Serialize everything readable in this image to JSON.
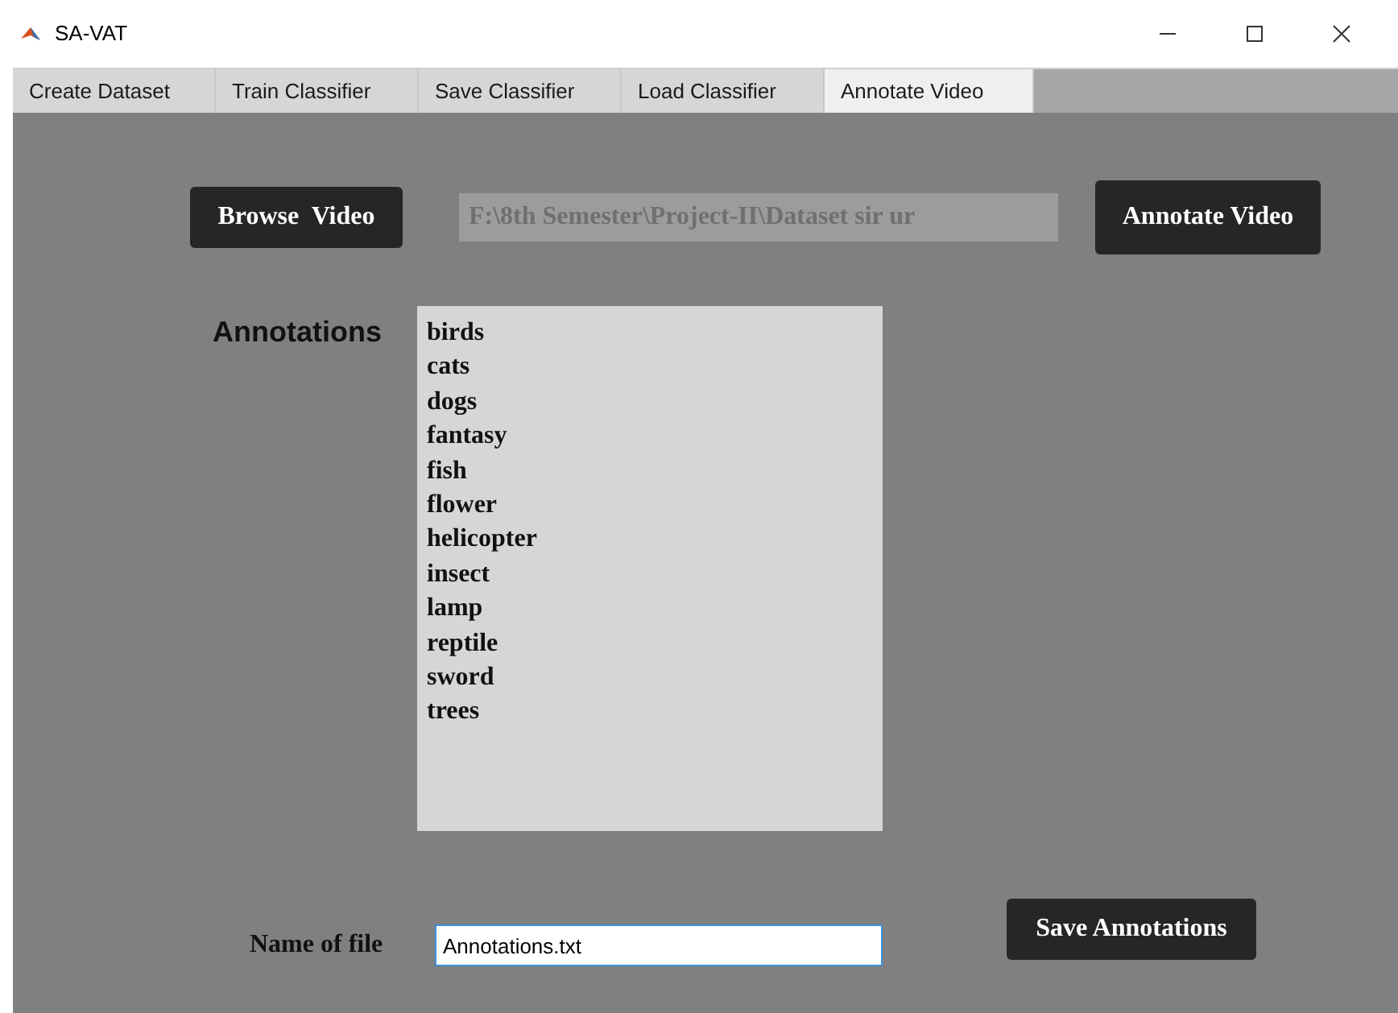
{
  "window": {
    "title": "SA-VAT"
  },
  "tabs": [
    {
      "label": "Create Dataset",
      "selected": false
    },
    {
      "label": "Train Classifier",
      "selected": false
    },
    {
      "label": "Save Classifier",
      "selected": false
    },
    {
      "label": "Load Classifier",
      "selected": false
    },
    {
      "label": "Annotate Video",
      "selected": true
    }
  ],
  "browse_button": "Browse  Video",
  "path_field": {
    "value": "F:\\8th Semester\\Project-II\\Dataset sir ur"
  },
  "annotate_button": "Annotate Video",
  "annotations": {
    "label": "Annotations",
    "items": [
      "birds",
      "cats",
      "dogs",
      "fantasy",
      "fish",
      "flower",
      "helicopter",
      "insect",
      "lamp",
      "reptile",
      "sword",
      "trees"
    ]
  },
  "file_name": {
    "label": "Name of file",
    "value": "Annotations.txt"
  },
  "save_button": "Save Annotations"
}
